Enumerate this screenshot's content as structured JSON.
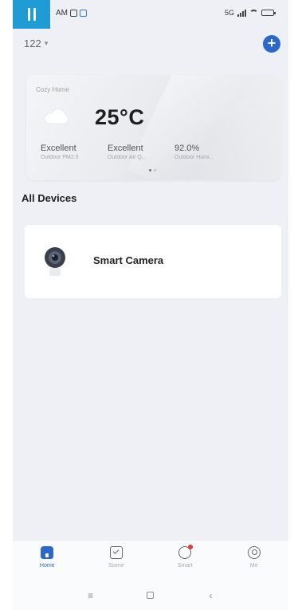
{
  "status_bar": {
    "time_suffix": "AM",
    "network_label": "5G"
  },
  "header": {
    "home_name": "122",
    "caret": "▾",
    "add_symbol": "+"
  },
  "weather": {
    "home_label": "Cozy Home",
    "temperature": "25°C",
    "icon": "cloud-icon",
    "metrics": [
      {
        "value": "Excellent",
        "label": "Outdoor PM2.5"
      },
      {
        "value": "Excellent",
        "label": "Outdoor Air Q..."
      },
      {
        "value": "92.0%",
        "label": "Outdoor Humi..."
      }
    ]
  },
  "devices": {
    "section_title": "All Devices",
    "items": [
      {
        "name": "Smart Camera",
        "icon": "camera-icon"
      }
    ]
  },
  "bottom_nav": {
    "items": [
      {
        "label": "Home",
        "icon": "home-icon",
        "active": true
      },
      {
        "label": "Scene",
        "icon": "scene-icon",
        "active": false
      },
      {
        "label": "Smart",
        "icon": "smart-icon",
        "active": false
      },
      {
        "label": "Me",
        "icon": "me-icon",
        "active": false
      }
    ]
  },
  "system_nav": {
    "recents": "≡",
    "back": "‹"
  },
  "colors": {
    "accent": "#2b68c9",
    "badge": "#1f9bd6",
    "notification": "#e53935"
  }
}
